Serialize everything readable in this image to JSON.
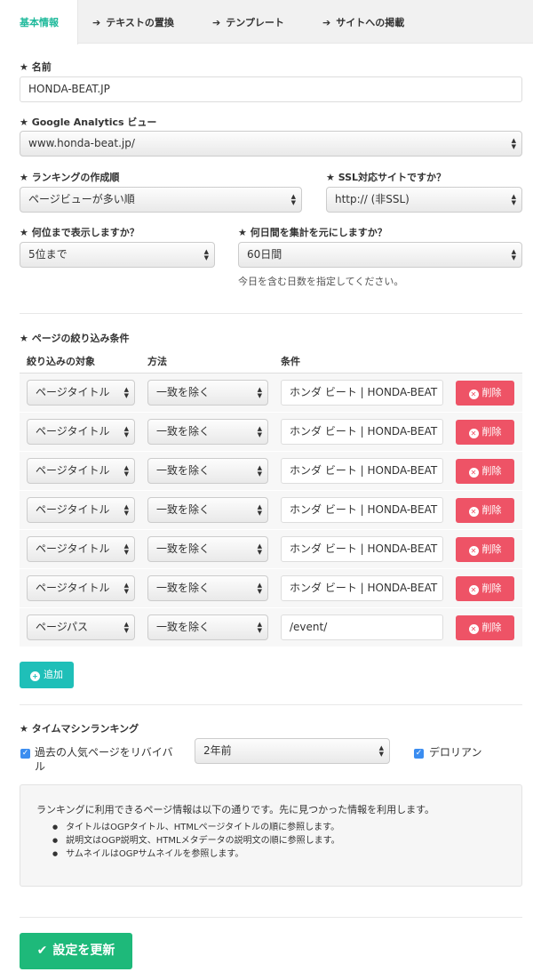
{
  "tabs": [
    {
      "label": "基本情報"
    },
    {
      "label": "テキストの置換"
    },
    {
      "label": "テンプレート"
    },
    {
      "label": "サイトへの掲載"
    }
  ],
  "name": {
    "label": "★ 名前",
    "value": "HONDA-BEAT.JP"
  },
  "ga_view": {
    "label": "★ Google Analytics ビュー",
    "value": "www.honda-beat.jp/"
  },
  "ranking_order": {
    "label": "★ ランキングの作成順",
    "value": "ページビューが多い順"
  },
  "ssl": {
    "label": "★ SSL対応サイトですか？",
    "value": "http:// (非SSL)"
  },
  "display_rank": {
    "label": "★ 何位まで表示しますか？",
    "value": "5位まで"
  },
  "days": {
    "label": "★ 何日間を集計を元にしますか？",
    "value": "60日間",
    "help": "今日を含む日数を指定してください。"
  },
  "filters": {
    "label": "★ ページの絞り込み条件",
    "headers": {
      "target": "絞り込みの対象",
      "method": "方法",
      "condition": "条件"
    },
    "delete_label": "削除",
    "rows": [
      {
        "target": "ページタイトル",
        "method": "一致を除く",
        "condition": "ホンダ ビート | HONDA-BEAT"
      },
      {
        "target": "ページタイトル",
        "method": "一致を除く",
        "condition": "ホンダ ビート | HONDA-BEAT"
      },
      {
        "target": "ページタイトル",
        "method": "一致を除く",
        "condition": "ホンダ ビート | HONDA-BEAT"
      },
      {
        "target": "ページタイトル",
        "method": "一致を除く",
        "condition": "ホンダ ビート | HONDA-BEAT"
      },
      {
        "target": "ページタイトル",
        "method": "一致を除く",
        "condition": "ホンダ ビート | HONDA-BEAT"
      },
      {
        "target": "ページタイトル",
        "method": "一致を除く",
        "condition": "ホンダ ビート | HONDA-BEAT"
      },
      {
        "target": "ページパス",
        "method": "一致を除く",
        "condition": "/event/"
      }
    ],
    "add_label": "追加"
  },
  "timemachine": {
    "label": "★ タイムマシンランキング",
    "revive_label": "過去の人気ページをリバイバル",
    "revive_checked": true,
    "period": "2年前",
    "delorean_label": "デロリアン",
    "delorean_checked": true
  },
  "info": {
    "intro": "ランキングに利用できるページ情報は以下の通りです。先に見つかった情報を利用します。",
    "items": [
      "タイトルはOGPタイトル、HTMLページタイトルの順に参照します。",
      "説明文はOGP説明文、HTMLメタデータの説明文の順に参照します。",
      "サムネイルはOGPサムネイルを参照します。"
    ]
  },
  "save_label": "設定を更新",
  "colors": {
    "accent": "#1eb99b",
    "delete": "#ee5366",
    "add": "#1fbfb8",
    "save": "#1eb97a",
    "checkbox": "#3b8df0"
  }
}
